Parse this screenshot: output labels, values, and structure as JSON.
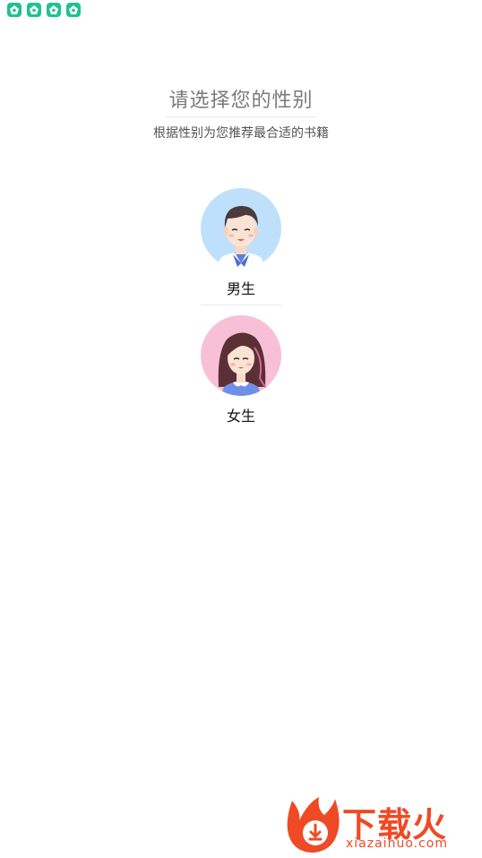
{
  "status_bar": {
    "icons": [
      "app-notification-icon",
      "app-notification-icon",
      "app-notification-icon",
      "app-notification-icon"
    ]
  },
  "header": {
    "title": "请选择您的性别",
    "subtitle": "根据性别为您推荐最合适的书籍"
  },
  "options": [
    {
      "label": "男生",
      "avatar": "male-avatar",
      "bg_color": "#bfe0fb"
    },
    {
      "label": "女生",
      "avatar": "female-avatar",
      "bg_color": "#f7c0d6"
    }
  ],
  "watermark": {
    "brand": "下载火",
    "domain": "xiazaihuo.com",
    "color": "#ef4a25"
  }
}
